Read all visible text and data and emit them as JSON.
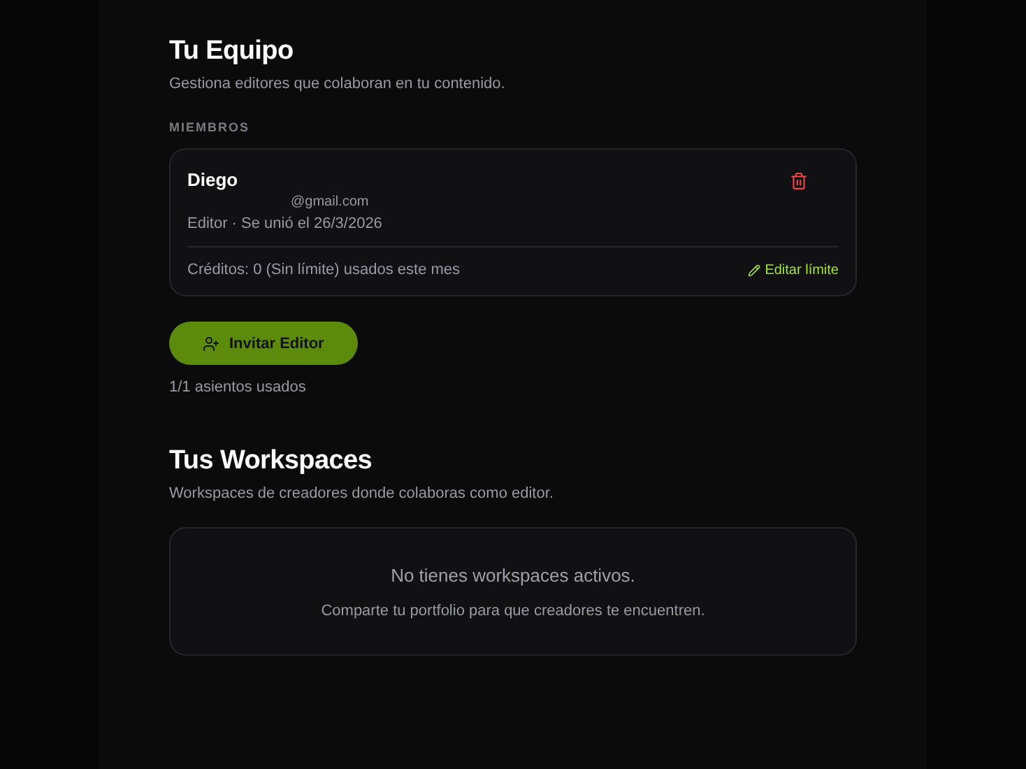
{
  "team": {
    "title": "Tu Equipo",
    "subtitle": "Gestiona editores que colaboran en tu contenido.",
    "members_label": "MIEMBROS",
    "members": [
      {
        "name": "Diego",
        "email": "@gmail.com",
        "meta": "Editor · Se unió el 26/3/2026",
        "credits": "Créditos: 0 (Sin límite) usados este mes",
        "edit_label": "Editar límite"
      }
    ],
    "invite_button": "Invitar Editor",
    "seats": "1/1 asientos usados"
  },
  "workspaces": {
    "title": "Tus Workspaces",
    "subtitle": "Workspaces de creadores donde colaboras como editor.",
    "empty_title": "No tienes workspaces activos.",
    "empty_hint": "Comparte tu portfolio para que creadores te encuentren."
  }
}
